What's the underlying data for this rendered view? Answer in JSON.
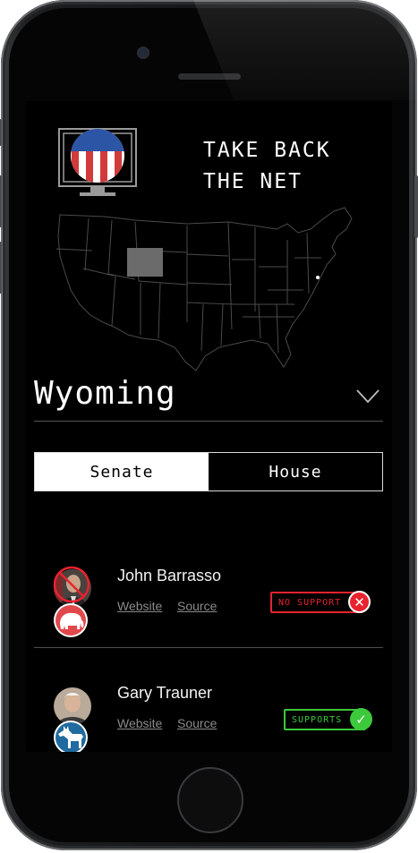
{
  "app": {
    "title_line1": "TAKE BACK",
    "title_line2": "THE NET"
  },
  "colors": {
    "background": "#000000",
    "no_support": "#e8232f",
    "supports": "#3cc93c",
    "republican": "#e0484c",
    "democrat": "#1f6a9e",
    "highlight_state": "#6b6b6b"
  },
  "map": {
    "highlighted_state": "Wyoming"
  },
  "state_selector": {
    "value": "Wyoming",
    "icon": "chevron-down-icon"
  },
  "tabs": [
    {
      "label": "Senate",
      "active": true
    },
    {
      "label": "House",
      "active": false
    }
  ],
  "representatives": [
    {
      "name": "John Barrasso",
      "party": "republican",
      "party_icon": "elephant-icon",
      "website_label": "Website",
      "source_label": "Source",
      "status_label": "NO SUPPORT",
      "status_icon": "x-icon"
    },
    {
      "name": "Gary Trauner",
      "party": "democrat",
      "party_icon": "donkey-icon",
      "website_label": "Website",
      "source_label": "Source",
      "status_label": "SUPPORTS",
      "status_icon": "check-icon"
    }
  ]
}
